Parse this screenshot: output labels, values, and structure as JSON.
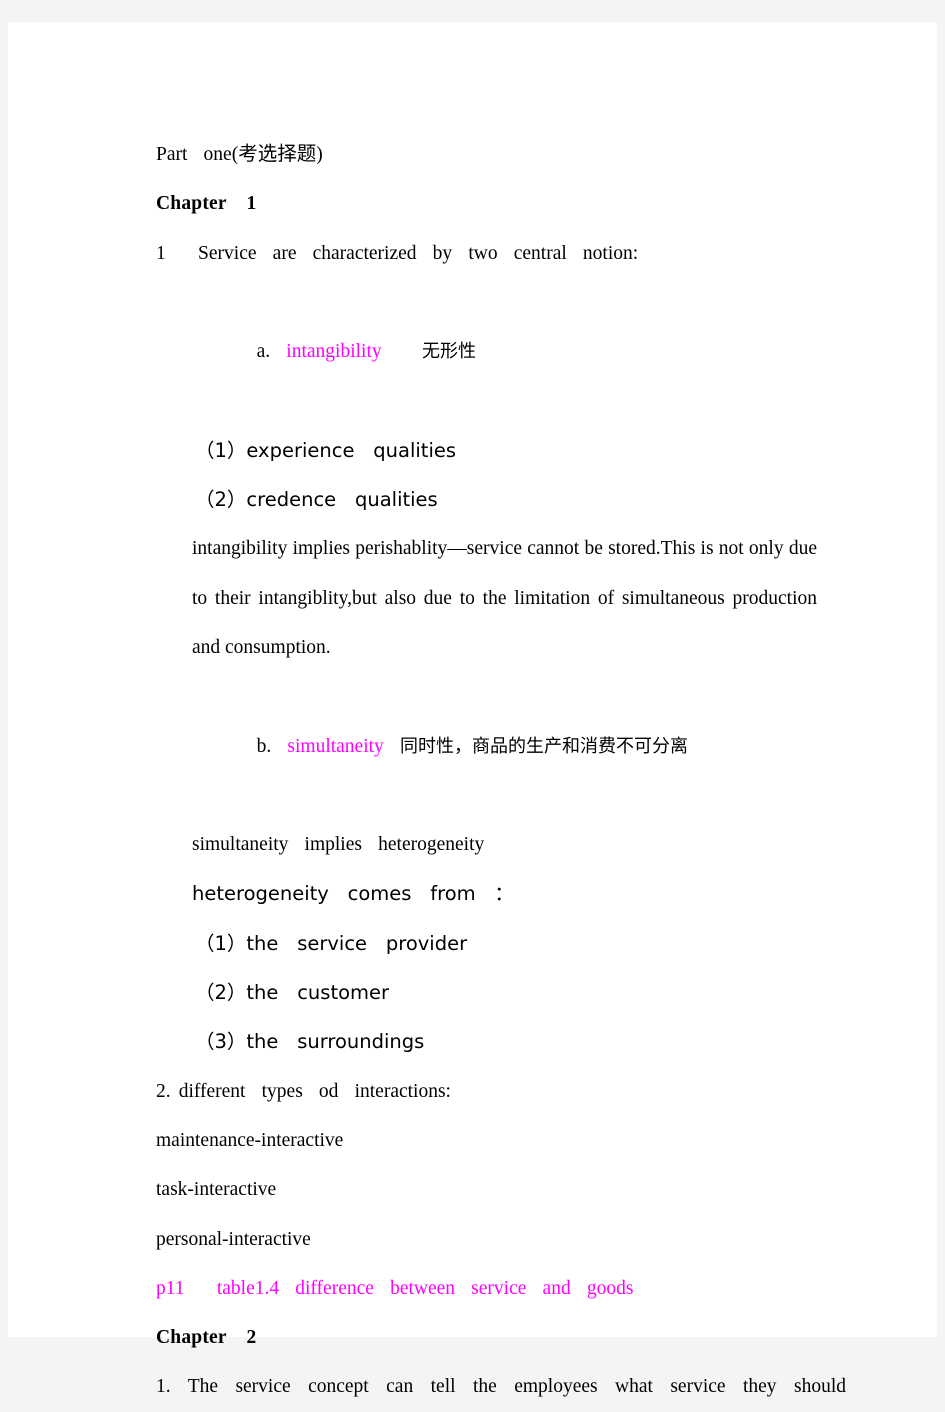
{
  "document": {
    "part_heading": "Part  one(考选择题)",
    "chapter1_heading": "Chapter  1",
    "chapter2_heading": "Chapter  2",
    "accent_color": "#ff00ff",
    "text_color": "#000000",
    "page_background": "#ffffff",
    "viewer_background": "#f4f4f4"
  },
  "chapter1": {
    "item1_intro": "1    Service  are  characterized  by  two  central  notion:",
    "point_a": {
      "marker": "a.",
      "term": "intangibility",
      "gloss": "无形性",
      "sub_items": [
        "（1）experience  qualities",
        "（2）credence  qualities"
      ],
      "paragraph": "intangibility  implies  perishablity—service  cannot  be  stored.This  is  not  only  due  to  their  intangiblity,but  also  due  to  the  limitation  of  simultaneous  production  and  consumption."
    },
    "point_b": {
      "marker": "b.",
      "term": "simultaneity",
      "gloss": "同时性，商品的生产和消费不可分离",
      "implies_line": "simultaneity  implies  heterogeneity",
      "comes_from_line": "heterogeneity  comes  from  ：",
      "sub_items": [
        "（1）the  service  provider",
        "（2）the  customer",
        "（3）the  surroundings"
      ]
    },
    "item2_intro": "2. different  types  od  interactions:",
    "item2_list": [
      "maintenance-interactive",
      "task-interactive",
      "personal-interactive"
    ],
    "reference_note": "p11    table1.4  difference  between  service  and  goods"
  },
  "chapter2": {
    "item1_line": "1. The  service  concept  can  tell  the  employees  what  service  they  should"
  }
}
